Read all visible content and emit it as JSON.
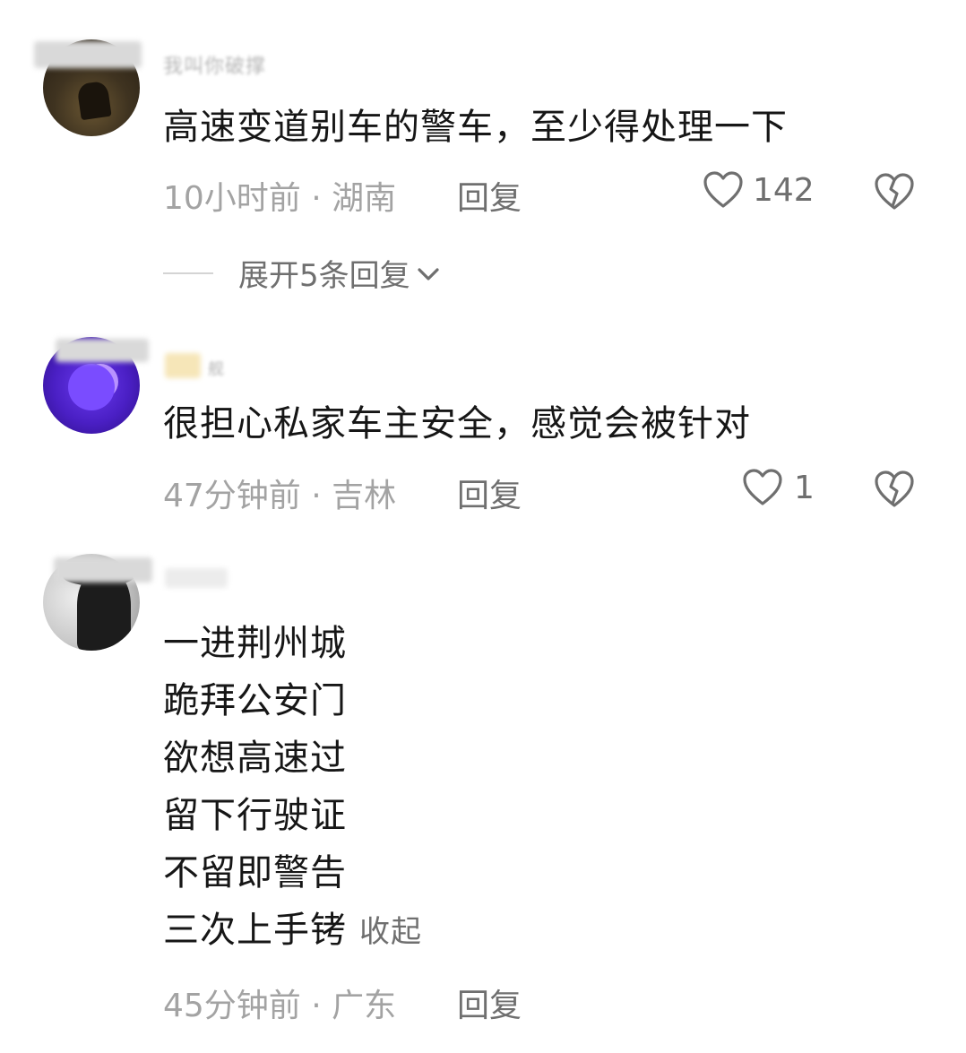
{
  "comments": [
    {
      "username": "我叫你破撑",
      "text": "高速变道别车的警车，至少得处理一下",
      "time_location": "10小时前 · 湖南",
      "reply_label": "回复",
      "likes": "142",
      "expand_label": "展开5条回复"
    },
    {
      "username": "舰",
      "text": "很担心私家车主安全，感觉会被针对",
      "time_location": "47分钟前 · 吉林",
      "reply_label": "回复",
      "likes": "1"
    },
    {
      "username": "",
      "lines": [
        "一进荆州城",
        "跪拜公安门",
        "欲想高速过",
        "留下行驶证",
        "不留即警告",
        "三次上手铐"
      ],
      "collapse_label": "收起",
      "time_location": "45分钟前 · 广东",
      "reply_label": "回复"
    }
  ],
  "icons": {
    "like": "heart-outline-icon",
    "dislike": "broken-heart-icon",
    "expand": "chevron-down-icon"
  },
  "colors": {
    "text": "#161616",
    "meta": "#a3a3a3",
    "action": "#6f6f6f",
    "avatar2_accent": "#5b2be0"
  }
}
